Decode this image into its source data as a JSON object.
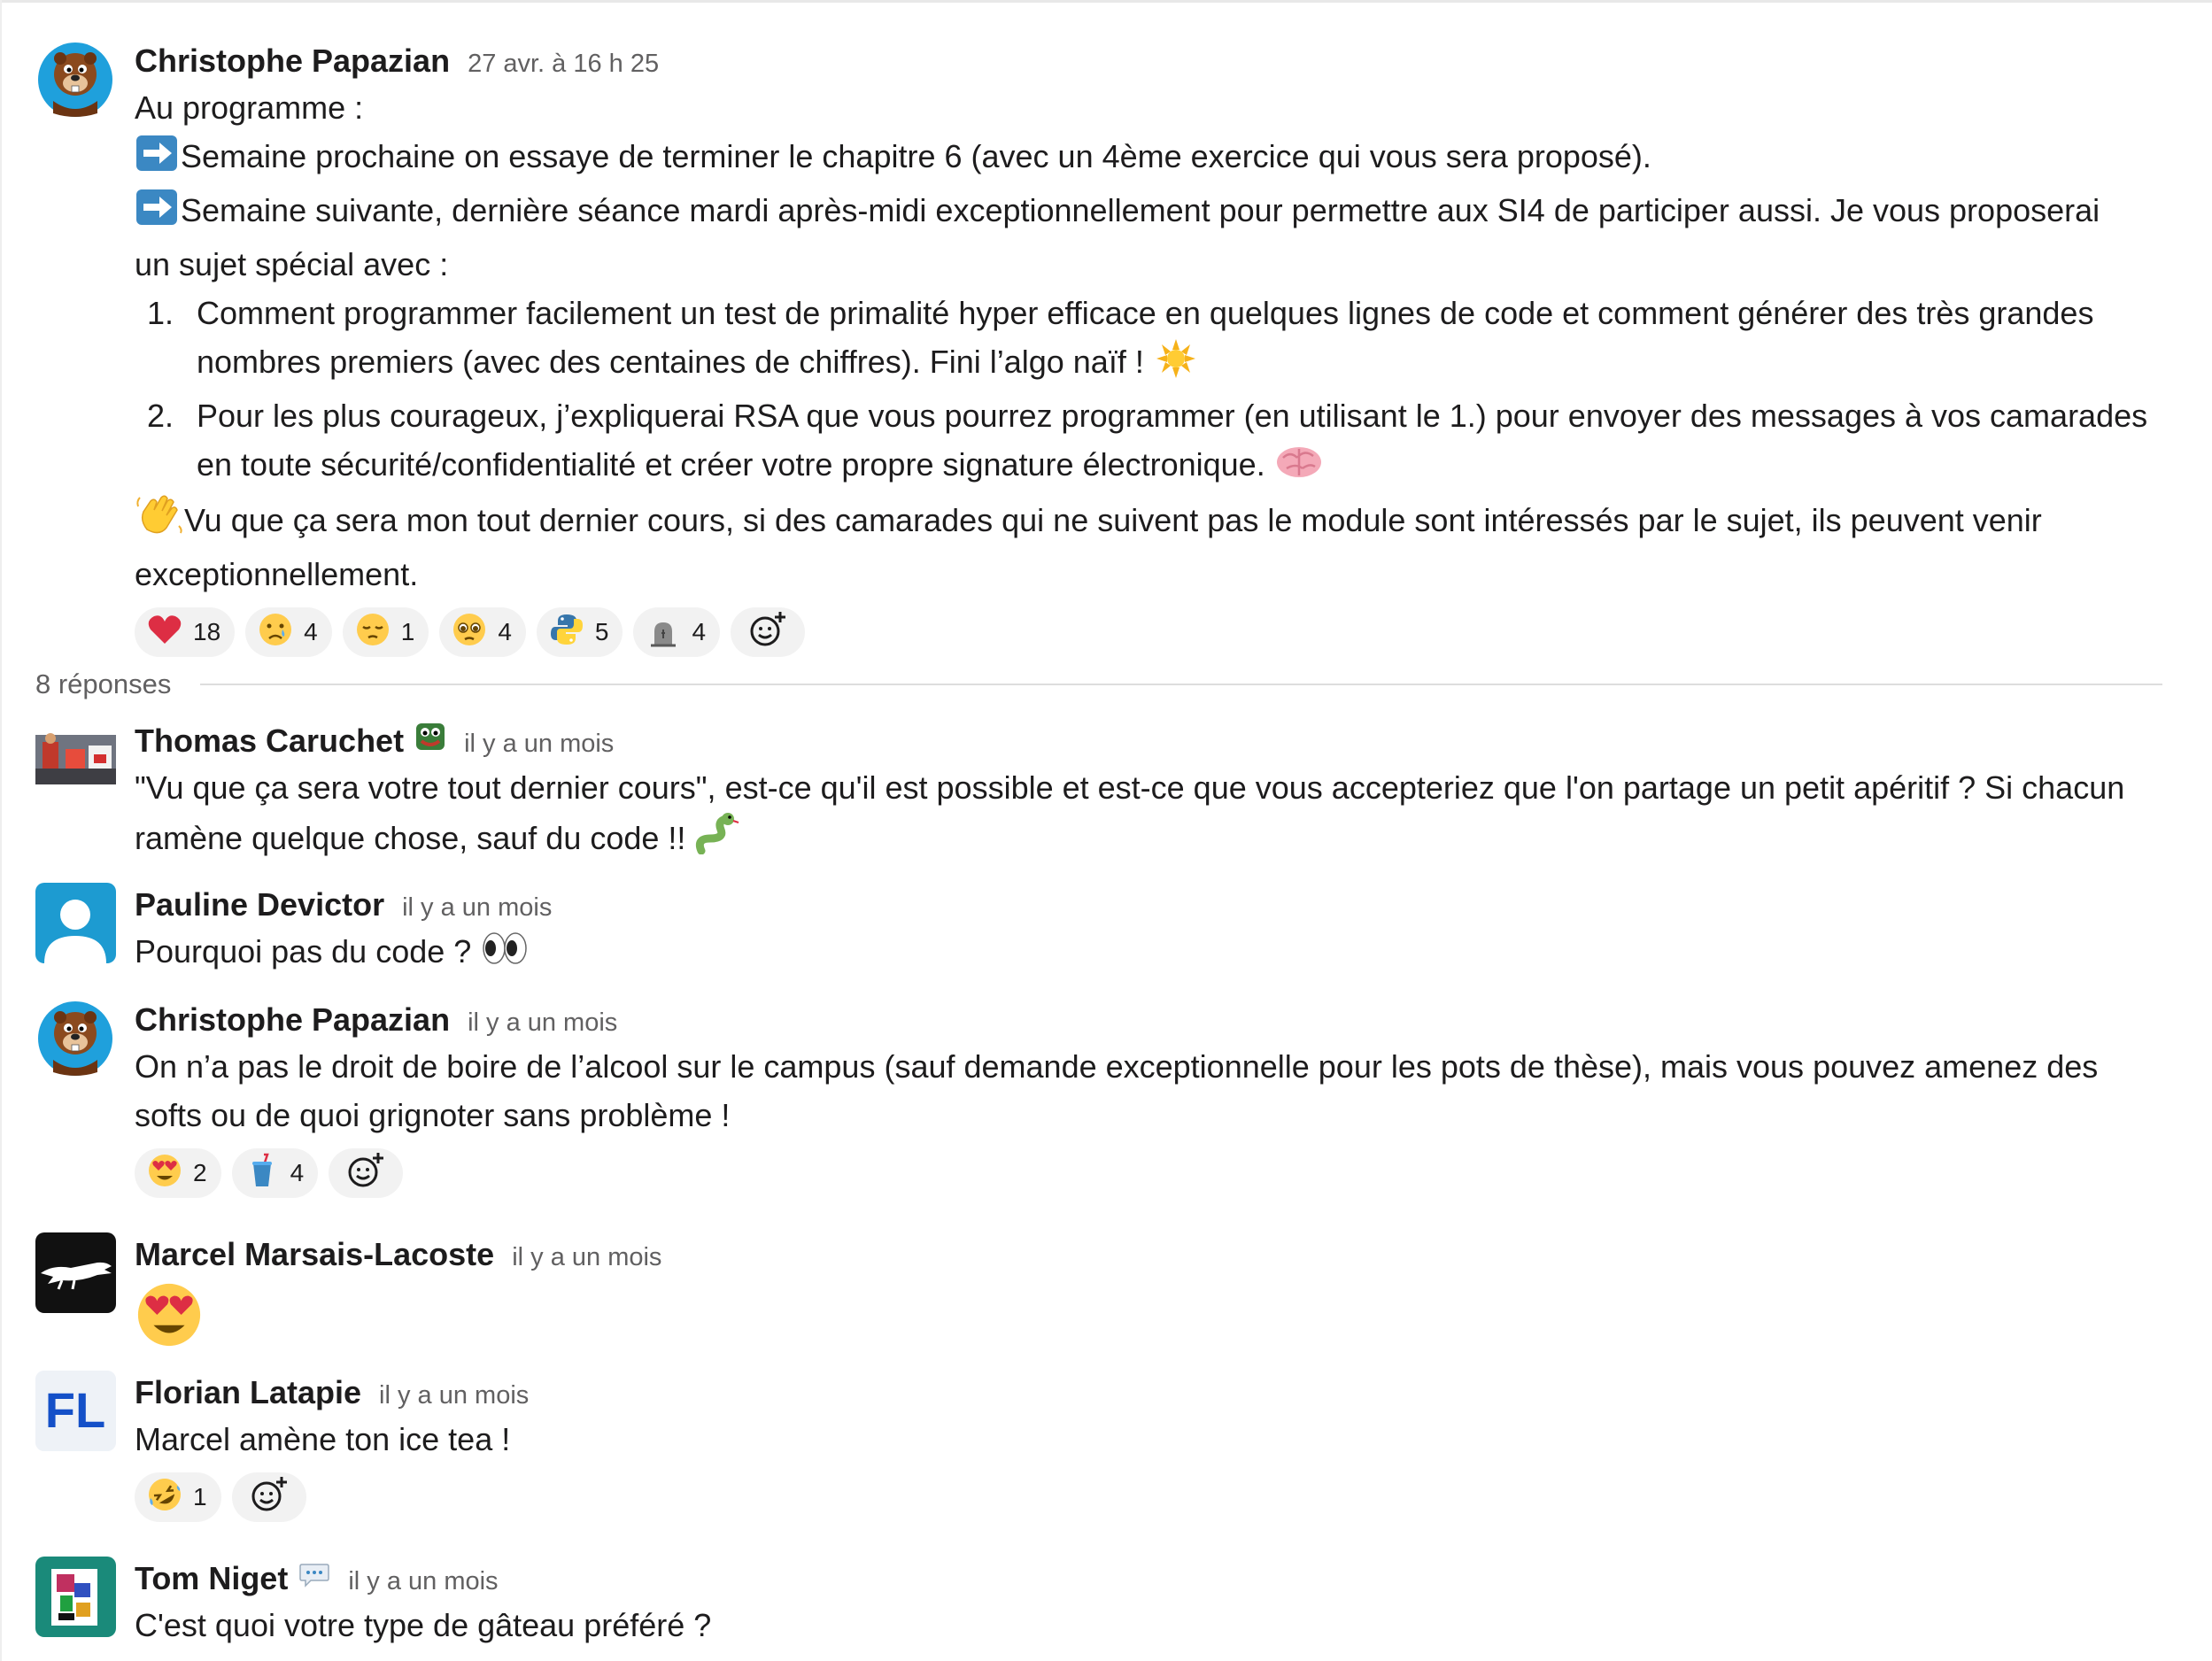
{
  "thread": {
    "parent": {
      "author": "Christophe Papazian",
      "timestamp": "27 avr. à 16 h 25",
      "lines": {
        "intro": "Au programme :",
        "arrow1": "Semaine prochaine on essaye de terminer le chapitre 6 (avec un 4ème exercice qui vous sera proposé).",
        "arrow2_l1": "Semaine suivante, dernière séance mardi après-midi exceptionnellement pour permettre aux SI4 de participer aussi. Je vous proposerai",
        "arrow2_l2": "un sujet spécial avec :",
        "item1_num": "1.",
        "item1_l1": "Comment programmer facilement un test de primalité hyper efficace en quelques lignes de code et comment générer des très grandes",
        "item1_l2": "nombres premiers (avec des centaines de chiffres). Fini l’algo naïf !",
        "item2_num": "2.",
        "item2_l1": "Pour les plus courageux, j’expliquerai RSA que vous pourrez programmer (en utilisant le 1.) pour envoyer des messages à vos camarades",
        "item2_l2": "en toute sécurité/confidentialité et créer votre propre signature électronique.",
        "wave_l1": "Vu que ça sera mon tout dernier cours, si des camarades qui ne suivent pas le module sont intéressés par le sujet, ils peuvent venir",
        "wave_l2": "exceptionnellement."
      },
      "reactions": [
        {
          "icon": "heart-icon",
          "count": "18"
        },
        {
          "icon": "crying-face-icon",
          "count": "4"
        },
        {
          "icon": "pensive-face-icon",
          "count": "1"
        },
        {
          "icon": "pleading-face-icon",
          "count": "4"
        },
        {
          "icon": "python-icon",
          "count": "5"
        },
        {
          "icon": "tombstone-icon",
          "count": "4"
        }
      ]
    },
    "replies_label": "8 réponses",
    "replies": [
      {
        "author": "Thomas Caruchet",
        "timestamp": "il y a un mois",
        "text_l1": "\"Vu que ça sera votre tout dernier cours\", est-ce qu'il est possible et est-ce que vous accepteriez que l'on partage un petit apéritif ? Si chacun",
        "text_l2": "ramène quelque chose, sauf du code !!"
      },
      {
        "author": "Pauline Devictor",
        "timestamp": "il y a un mois",
        "text": "Pourquoi pas du code ?"
      },
      {
        "author": "Christophe Papazian",
        "timestamp": "il y a un mois",
        "text_l1": "On n’a pas le droit de boire de l’alcool sur le campus (sauf demande exceptionnelle pour les pots de thèse), mais vous pouvez amenez des",
        "text_l2": "softs ou de quoi grignoter sans problème !",
        "reactions": [
          {
            "icon": "heart-eyes-icon",
            "count": "2"
          },
          {
            "icon": "cup-with-straw-icon",
            "count": "4"
          }
        ]
      },
      {
        "author": "Marcel Marsais-Lacoste",
        "timestamp": "il y a un mois"
      },
      {
        "author": "Florian Latapie",
        "timestamp": "il y a un mois",
        "avatar_initials": "FL",
        "text": "Marcel amène ton ice tea !",
        "reactions": [
          {
            "icon": "rofl-icon",
            "count": "1"
          }
        ]
      },
      {
        "author": "Tom Niget",
        "timestamp": "il y a un mois",
        "text": "C'est quoi votre type de gâteau préféré ?"
      }
    ]
  },
  "colors": {
    "text": "#1d1c1d",
    "muted": "#616061",
    "reaction_bg": "#f2f2f2",
    "arrow_blue": "#3b88c3"
  }
}
